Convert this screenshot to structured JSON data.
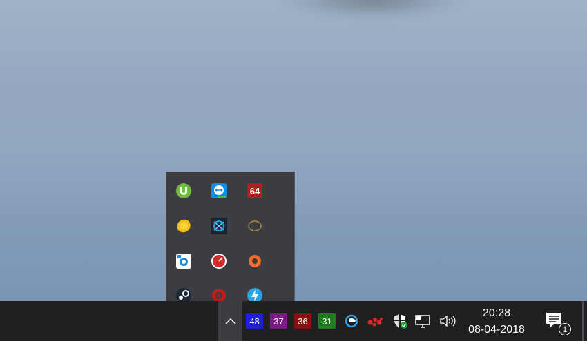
{
  "tray_overflow": {
    "icons": [
      {
        "name": "utorrent-icon"
      },
      {
        "name": "teamviewer-icon"
      },
      {
        "name": "aida64-icon",
        "label": "64"
      },
      {
        "name": "lemon-icon"
      },
      {
        "name": "battlenet-icon"
      },
      {
        "name": "gold-ring-icon"
      },
      {
        "name": "uplay-icon"
      },
      {
        "name": "msi-afterburner-icon"
      },
      {
        "name": "origin-icon"
      },
      {
        "name": "steam-icon"
      },
      {
        "name": "red-gear-icon"
      },
      {
        "name": "blue-lightning-icon"
      }
    ]
  },
  "taskbar": {
    "temps": [
      {
        "value": "48",
        "color": "#1f1fd8"
      },
      {
        "value": "37",
        "color": "#7c1a86"
      },
      {
        "value": "36",
        "color": "#8c1010"
      },
      {
        "value": "31",
        "color": "#1d7d1d"
      }
    ],
    "sys_icons": [
      "onedrive-icon",
      "bird-network-icon",
      "security-shield-icon",
      "network-icon",
      "volume-icon"
    ],
    "clock": {
      "time": "20:28",
      "date": "08-04-2018"
    },
    "notifications": {
      "count": "1"
    }
  }
}
